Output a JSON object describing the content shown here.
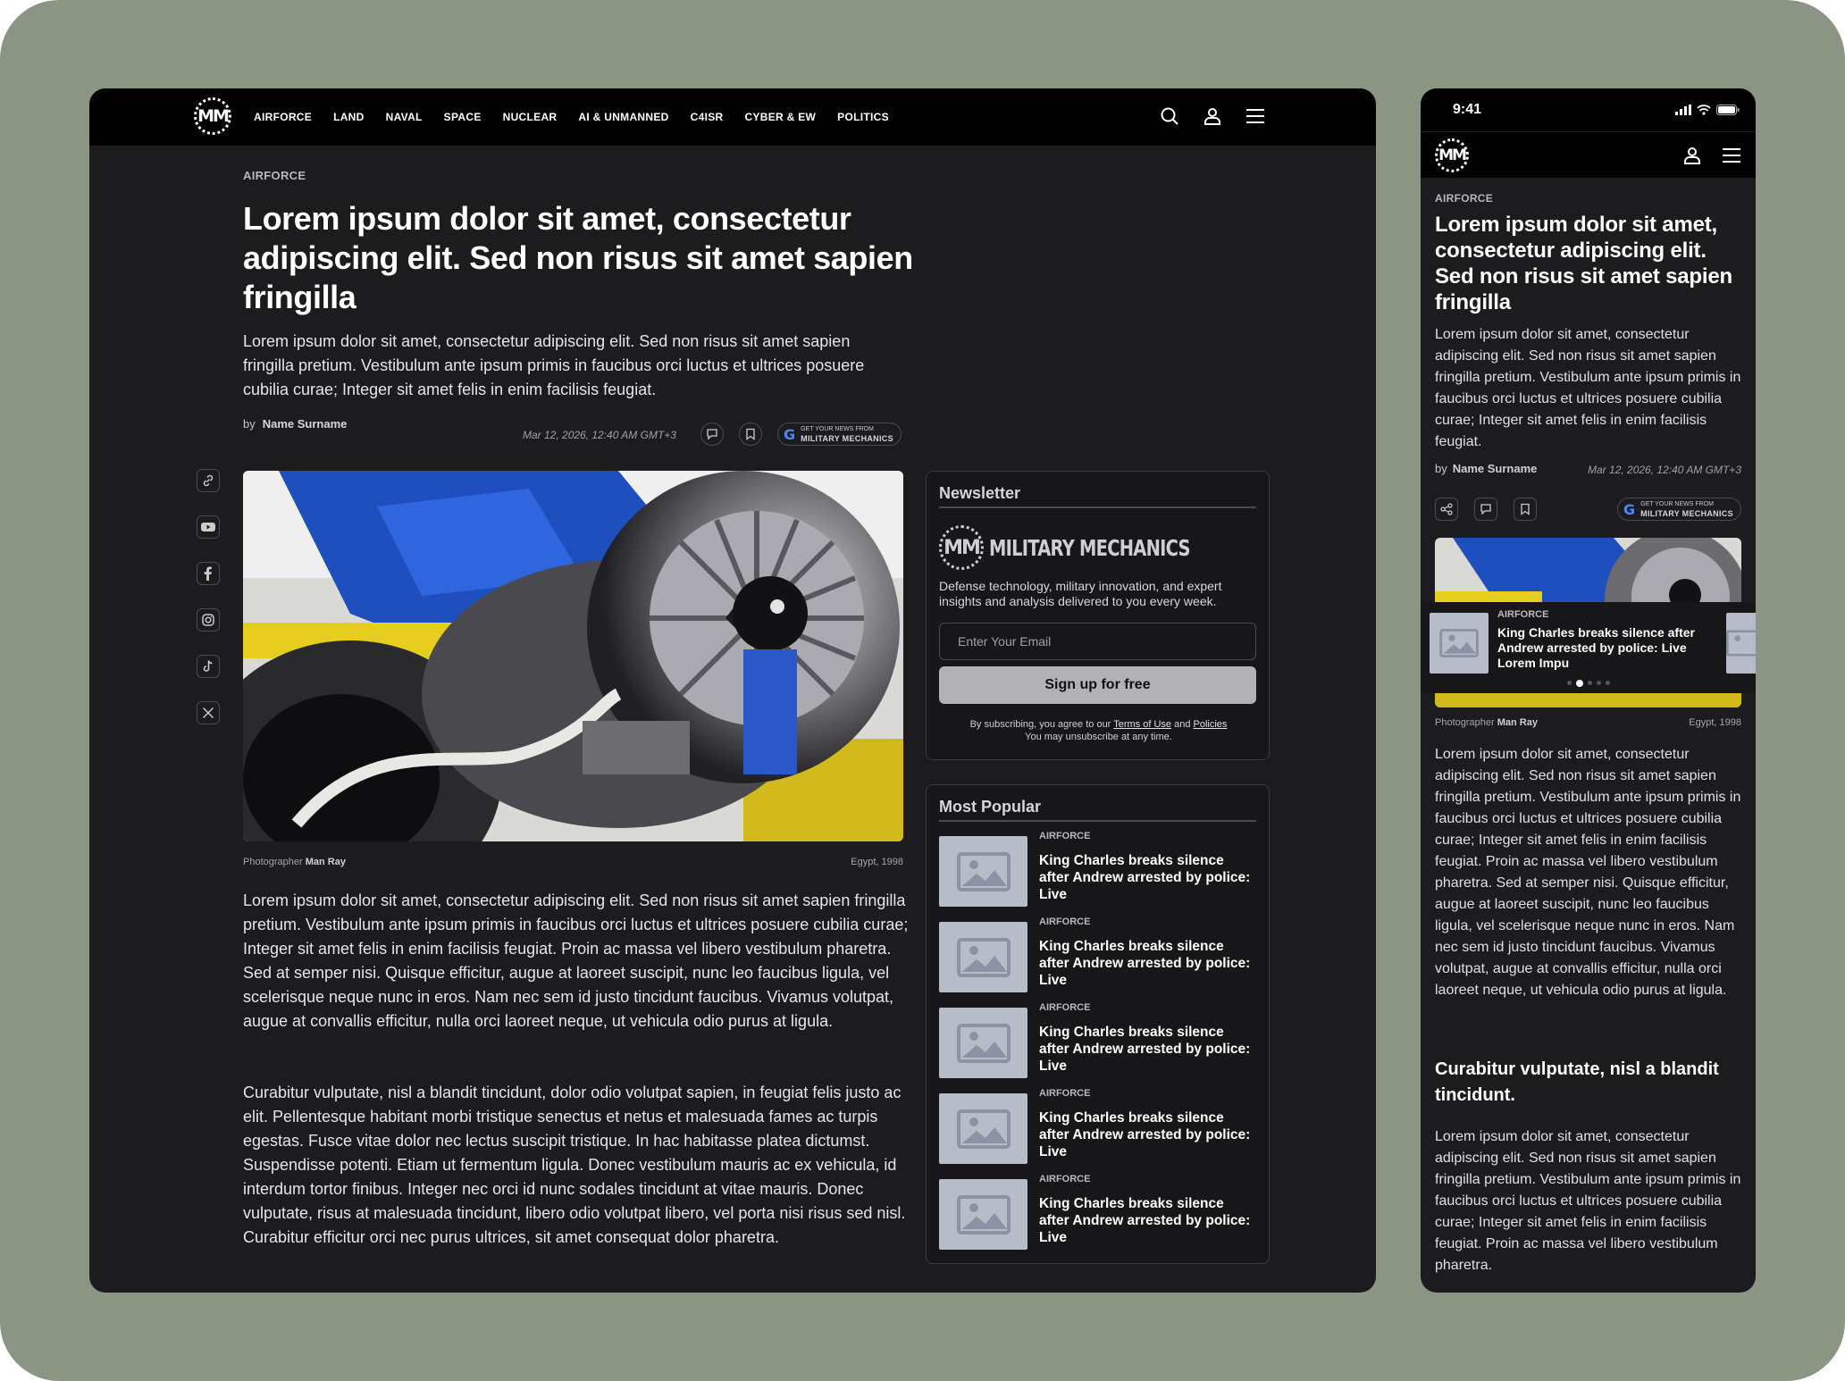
{
  "brand": {
    "logo_text": "MM",
    "name": "MILITARY MECHANICS"
  },
  "nav": {
    "links": [
      "AIRFORCE",
      "LAND",
      "NAVAL",
      "SPACE",
      "NUCLEAR",
      "AI & UNMANNED",
      "C4ISR",
      "CYBER & EW",
      "POLITICS"
    ],
    "icons": [
      "search-icon",
      "user-icon",
      "menu-icon"
    ]
  },
  "article": {
    "category": "AIRFORCE",
    "title": "Lorem ipsum dolor sit amet, consectetur adipiscing elit. Sed non risus sit amet sapien fringilla",
    "lead": "Lorem ipsum dolor sit amet, consectetur adipiscing elit. Sed non risus sit amet sapien fringilla pretium. Vestibulum ante ipsum primis in faucibus orci luctus et ultrices posuere cubilia curae; Integer sit amet felis in enim facilisis feugiat.",
    "by_label": "by",
    "author": "Name Surname",
    "date": "Mar 12, 2026, 12:40 AM GMT+3",
    "google_small": "GET YOUR NEWS FROM",
    "google_big": "MILITARY MECHANICS",
    "caption_label": "Photographer",
    "photographer": "Man Ray",
    "caption_place": "Egypt, 1998",
    "body1": "Lorem ipsum dolor sit amet, consectetur adipiscing elit. Sed non risus sit amet sapien fringilla pretium. Vestibulum ante ipsum primis in faucibus orci luctus et ultrices posuere cubilia curae; Integer sit amet felis in enim facilisis feugiat. Proin ac massa vel libero vestibulum pharetra. Sed at semper nisi. Quisque efficitur, augue at laoreet suscipit, nunc leo faucibus ligula, vel scelerisque neque nunc in eros. Nam nec sem id justo tincidunt faucibus. Vivamus volutpat, augue at convallis efficitur, nulla orci laoreet neque, ut vehicula odio purus at ligula.",
    "body2": "Curabitur vulputate, nisl a blandit tincidunt, dolor odio volutpat sapien, in feugiat felis justo ac elit. Pellentesque habitant morbi tristique senectus et netus et malesuada fames ac turpis egestas. Fusce vitae dolor nec lectus suscipit tristique. In hac habitasse platea dictumst. Suspendisse potenti. Etiam ut fermentum ligula. Donec vestibulum mauris ac ex vehicula, id interdum tortor finibus. Integer nec orci id nunc sodales tincidunt at vitae mauris. Donec vulputate, risus at malesuada tincidunt, libero odio volutpat libero, vel porta nisi risus sed nisl. Curabitur efficitur orci nec purus ultrices, sit amet consequat dolor pharetra."
  },
  "share_icons": [
    "link-icon",
    "youtube-icon",
    "facebook-icon",
    "instagram-icon",
    "tiktok-icon",
    "x-icon"
  ],
  "newsletter": {
    "heading": "Newsletter",
    "description": "Defense technology, military innovation, and expert insights and analysis delivered to you every week.",
    "email_placeholder": "Enter Your Email",
    "button_label": "Sign up for free",
    "legal_prefix": "By subscribing, you agree to our",
    "terms_link": "Terms of Use",
    "and_word": "and",
    "policies_link": "Policies",
    "legal_line2": "You may unsubscribe at any time."
  },
  "most_popular": {
    "heading": "Most Popular",
    "items": [
      {
        "category": "AIRFORCE",
        "title": "King Charles breaks silence after Andrew arrested by police: Live"
      },
      {
        "category": "AIRFORCE",
        "title": "King Charles breaks silence after Andrew arrested by police: Live"
      },
      {
        "category": "AIRFORCE",
        "title": "King Charles breaks silence after Andrew arrested by police: Live"
      },
      {
        "category": "AIRFORCE",
        "title": "King Charles breaks silence after Andrew arrested by police: Live"
      },
      {
        "category": "AIRFORCE",
        "title": "King Charles breaks silence after Andrew arrested by police: Live"
      }
    ]
  },
  "mobile": {
    "time": "9:41",
    "category": "AIRFORCE",
    "title": "Lorem ipsum dolor sit amet, consectetur adipiscing elit. Sed non risus sit amet sapien fringilla",
    "lead": "Lorem ipsum dolor sit amet, consectetur adipiscing elit. Sed non risus sit amet sapien fringilla pretium. Vestibulum ante ipsum primis in faucibus orci luctus et ultrices posuere cubilia curae; Integer sit amet felis in enim facilisis feugiat.",
    "by_label": "by",
    "author": "Name Surname",
    "date": "Mar 12, 2026, 12:40 AM GMT+3",
    "google_small": "GET YOUR NEWS FROM",
    "google_big": "MILITARY MECHANICS",
    "overlay_category": "AIRFORCE",
    "overlay_title": "King Charles breaks silence after Andrew arrested by police: Live Lorem Impu",
    "caption_label": "Photographer",
    "photographer": "Man Ray",
    "caption_place": "Egypt, 1998",
    "body1": "Lorem ipsum dolor sit amet, consectetur adipiscing elit. Sed non risus sit amet sapien fringilla pretium. Vestibulum ante ipsum primis in faucibus orci luctus et ultrices posuere cubilia curae; Integer sit amet felis in enim facilisis feugiat. Proin ac massa vel libero vestibulum pharetra. Sed at semper nisi. Quisque efficitur, augue at laoreet suscipit, nunc leo faucibus ligula, vel scelerisque neque nunc in eros. Nam nec sem id justo tincidunt faucibus. Vivamus volutpat, augue at convallis efficitur, nulla orci laoreet neque, ut vehicula odio purus at ligula.",
    "subheading": "Curabitur vulputate, nisl a blandit tincidunt.",
    "body2": "Lorem ipsum dolor sit amet, consectetur adipiscing elit. Sed non risus sit amet sapien fringilla pretium. Vestibulum ante ipsum primis in faucibus orci luctus et ultrices posuere cubilia curae; Integer sit amet felis in enim facilisis feugiat. Proin ac massa vel libero vestibulum pharetra."
  },
  "colors": {
    "page_bg": "#8a9683",
    "frame_bg": "#1c1c1f",
    "nav_bg": "#000000",
    "button_bg": "#b1b1b6",
    "thumb_bg": "#b6bcc8"
  }
}
